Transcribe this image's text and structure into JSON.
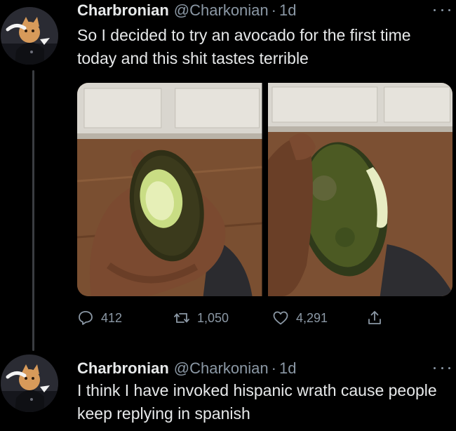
{
  "tweets": [
    {
      "author_name": "Charbronian",
      "author_handle": "@Charkonian",
      "separator": "·",
      "time": "1d",
      "text": "So I decided to try an avocado for the first time today and this shit tastes terrible",
      "media": [
        {
          "description_icon": "avocado-photo-bitten-top"
        },
        {
          "description_icon": "avocado-photo-bitten-side"
        }
      ],
      "stats": {
        "replies": "412",
        "retweets": "1,050",
        "likes": "4,291"
      }
    },
    {
      "author_name": "Charbronian",
      "author_handle": "@Charkonian",
      "separator": "·",
      "time": "1d",
      "text": "I think I have invoked hispanic wrath cause people keep replying in spanish"
    }
  ],
  "colors": {
    "background": "#000000",
    "text_primary": "#e7e9ea",
    "text_secondary": "#8b98a5",
    "thread_line": "#3a3d41"
  },
  "icons": {
    "reply": "reply-icon",
    "retweet": "retweet-icon",
    "like": "heart-icon",
    "share": "share-icon",
    "more": "more-icon"
  }
}
